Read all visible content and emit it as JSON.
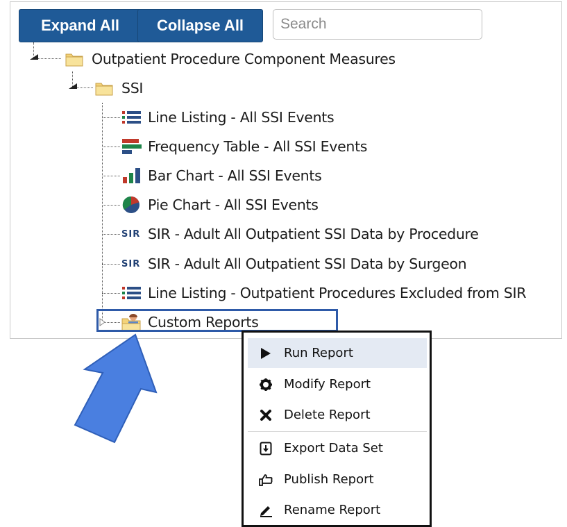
{
  "toolbar": {
    "expand_label": "Expand All",
    "collapse_label": "Collapse All",
    "search_placeholder": "Search"
  },
  "tree": {
    "root_folder": "Outpatient Procedure Component Measures",
    "sub_folder": "SSI",
    "items": [
      {
        "label": "Line Listing - All SSI Events",
        "icon": "line-listing-icon"
      },
      {
        "label": "Frequency Table - All SSI Events",
        "icon": "frequency-table-icon"
      },
      {
        "label": "Bar Chart - All SSI Events",
        "icon": "bar-chart-icon"
      },
      {
        "label": "Pie Chart - All SSI Events",
        "icon": "pie-chart-icon"
      },
      {
        "label": "SIR - Adult All Outpatient SSI Data by Procedure",
        "icon": "sir-icon"
      },
      {
        "label": "SIR - Adult All Outpatient SSI Data by Surgeon",
        "icon": "sir-icon"
      },
      {
        "label": "Line Listing - Outpatient Procedures Excluded from SIR",
        "icon": "line-listing-icon"
      }
    ],
    "custom_reports": "Custom Reports",
    "sir_badge": "SIR"
  },
  "context_menu": {
    "items": [
      {
        "label": "Run Report",
        "icon": "play-icon"
      },
      {
        "label": "Modify Report",
        "icon": "gear-icon"
      },
      {
        "label": "Delete Report",
        "icon": "x-icon"
      },
      {
        "label": "Export Data Set",
        "icon": "export-icon"
      },
      {
        "label": "Publish Report",
        "icon": "thumbs-up-icon"
      },
      {
        "label": "Rename Report",
        "icon": "pencil-icon"
      }
    ]
  },
  "colors": {
    "button_bg": "#1f5a97",
    "selection_border": "#2e5aa8",
    "arrow_fill": "#4a7fe0",
    "menu_highlight": "#e4eaf3"
  }
}
